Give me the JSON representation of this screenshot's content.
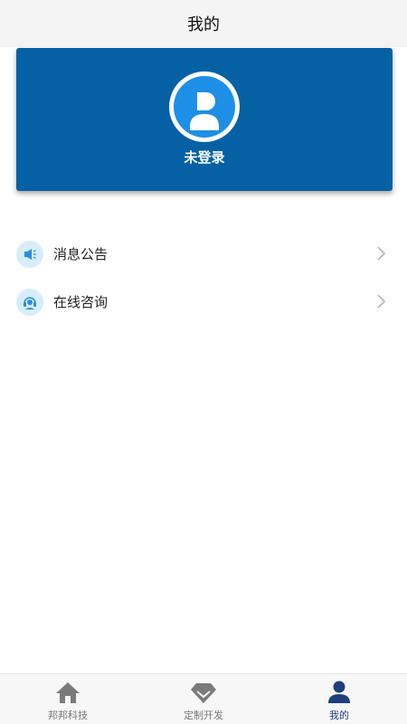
{
  "header": {
    "title": "我的"
  },
  "profile": {
    "status_text": "未登录",
    "avatar_icon": "user-avatar-icon",
    "card_color": "#0561a3"
  },
  "menu": {
    "items": [
      {
        "label": "消息公告",
        "icon": "megaphone-icon"
      },
      {
        "label": "在线咨询",
        "icon": "headset-icon"
      }
    ]
  },
  "tabbar": {
    "items": [
      {
        "label": "邦邦科技",
        "icon": "home-icon",
        "active": false
      },
      {
        "label": "定制开发",
        "icon": "diamond-icon",
        "active": false
      },
      {
        "label": "我的",
        "icon": "person-icon",
        "active": true
      }
    ],
    "active_color": "#1e3f7a",
    "inactive_color": "#777777"
  }
}
